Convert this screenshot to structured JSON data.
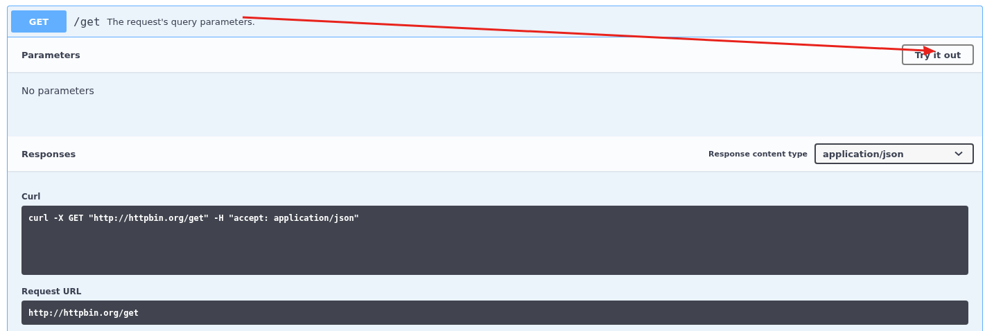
{
  "operation": {
    "method": "GET",
    "path": "/get",
    "summary": "The request's query parameters."
  },
  "parameters": {
    "title": "Parameters",
    "try_button": "Try it out",
    "empty_text": "No parameters"
  },
  "responses": {
    "title": "Responses",
    "content_type_label": "Response content type",
    "content_type": "application/json"
  },
  "curl": {
    "label": "Curl",
    "command": "curl -X GET \"http://httpbin.org/get\" -H \"accept: application/json\""
  },
  "request_url": {
    "label": "Request URL",
    "url": "http://httpbin.org/get"
  },
  "annotation": {
    "kind": "arrow"
  }
}
